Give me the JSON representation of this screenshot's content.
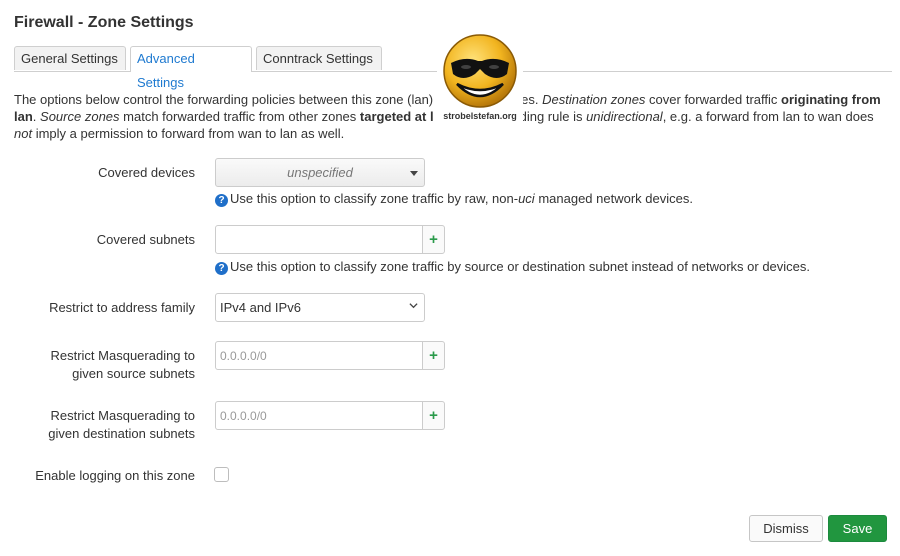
{
  "dialog": {
    "title": "Firewall - Zone Settings"
  },
  "tabs": [
    {
      "label": "General Settings",
      "active": false
    },
    {
      "label": "Advanced Settings",
      "active": true
    },
    {
      "label": "Conntrack Settings",
      "active": false
    }
  ],
  "watermark": {
    "text": "strobelstefan.org"
  },
  "description": {
    "p1": "The options below control the forwarding policies between this zone (lan)",
    "p2": "es. ",
    "dest_zones": "Destination zones",
    "p3": " cover forwarded traffic ",
    "orig_from": "originating from lan",
    "p4": ". ",
    "source_zones": "Source zones",
    "p5": " match forwarded traffic from other zones ",
    "targeted": "targeted at l",
    "p6": "ding rule is ",
    "unidirectional": "unidirectional",
    "p7": ", e.g. a forward from lan to wan does ",
    "not": "not",
    "p8": " imply a permission to forward from wan to lan as well."
  },
  "form": {
    "covered_devices": {
      "label": "Covered devices",
      "value": "unspecified",
      "help_pre": "Use this option to classify zone traffic by raw, non-",
      "help_em": "uci",
      "help_post": " managed network devices."
    },
    "covered_subnets": {
      "label": "Covered subnets",
      "value": "",
      "help": "Use this option to classify zone traffic by source or destination subnet instead of networks or devices."
    },
    "address_family": {
      "label": "Restrict to address family",
      "value": "IPv4 and IPv6"
    },
    "masq_src": {
      "label_line1": "Restrict Masquerading to",
      "label_line2": "given source subnets",
      "placeholder": "0.0.0.0/0"
    },
    "masq_dest": {
      "label_line1": "Restrict Masquerading to",
      "label_line2": "given destination subnets",
      "placeholder": "0.0.0.0/0"
    },
    "logging": {
      "label": "Enable logging on this zone",
      "checked": false
    },
    "add_glyph": "+",
    "help_glyph": "?"
  },
  "buttons": {
    "dismiss": "Dismiss",
    "save": "Save"
  },
  "colors": {
    "accent": "#1f7ad0",
    "save": "#21963f",
    "add": "#2a9a4a",
    "help_icon": "#1f6fc9"
  }
}
